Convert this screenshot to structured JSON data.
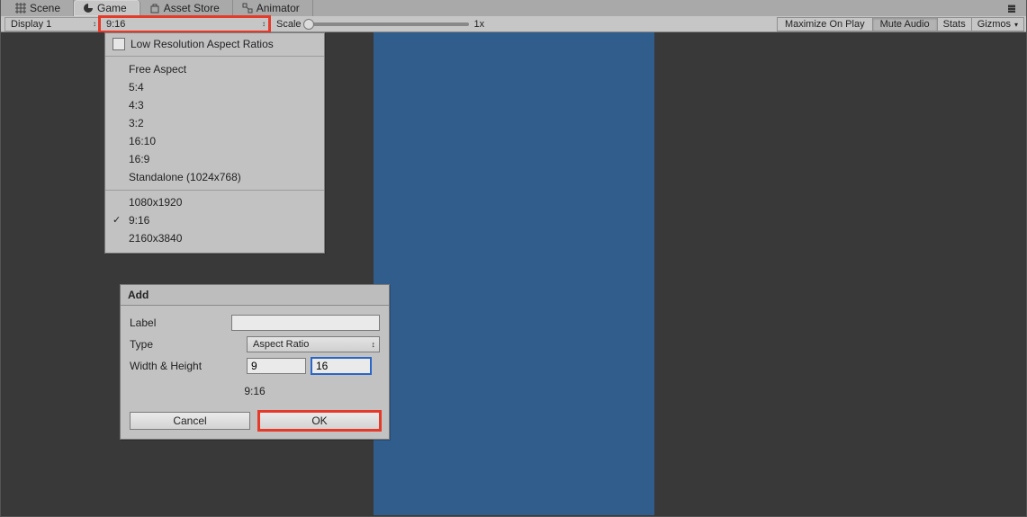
{
  "tabs": {
    "scene": "Scene",
    "game": "Game",
    "asset_store": "Asset Store",
    "animator": "Animator"
  },
  "toolbar": {
    "display_label": "Display 1",
    "aspect_label": "9:16",
    "scale_label": "Scale",
    "scale_value": "1x",
    "maximize": "Maximize On Play",
    "mute": "Mute Audio",
    "stats": "Stats",
    "gizmos": "Gizmos"
  },
  "aspect_menu": {
    "low_res": "Low Resolution Aspect Ratios",
    "items_a": [
      "Free Aspect",
      "5:4",
      "4:3",
      "3:2",
      "16:10",
      "16:9",
      "Standalone (1024x768)"
    ],
    "items_b": [
      "1080x1920",
      "9:16",
      "2160x3840"
    ],
    "selected": "9:16"
  },
  "add_dialog": {
    "title": "Add",
    "label_label": "Label",
    "label_value": "",
    "type_label": "Type",
    "type_value": "Aspect Ratio",
    "wh_label": "Width & Height",
    "width_value": "9",
    "height_value": "16",
    "preview": "9:16",
    "cancel": "Cancel",
    "ok": "OK"
  }
}
